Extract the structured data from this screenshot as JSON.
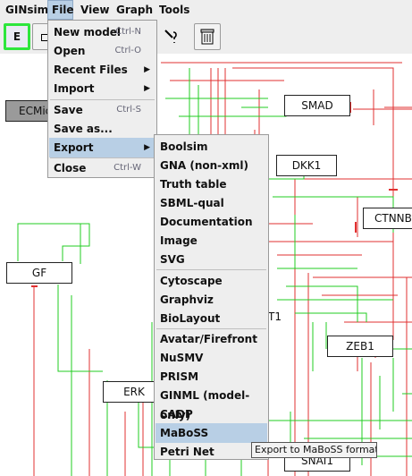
{
  "menubar": {
    "items": [
      {
        "label": "GINsim"
      },
      {
        "label": "File"
      },
      {
        "label": "View"
      },
      {
        "label": "Graph"
      },
      {
        "label": "Tools"
      }
    ]
  },
  "toolbar": {
    "edit_label": "E",
    "icons": [
      "edit-mode-icon",
      "add-node-icon",
      "add-edge-icon",
      "trash-icon"
    ]
  },
  "graph": {
    "nodes": [
      {
        "label": "ECMic"
      },
      {
        "label": "SMAD"
      },
      {
        "label": "DKK1"
      },
      {
        "label": "CTNNB"
      },
      {
        "label": "GF"
      },
      {
        "label": "T1"
      },
      {
        "label": "ZEB1"
      },
      {
        "label": "ERK"
      },
      {
        "label": "SNAI1"
      }
    ]
  },
  "file_menu": {
    "items": [
      {
        "label": "New model",
        "accel": "Ctrl-N"
      },
      {
        "label": "Open",
        "accel": "Ctrl-O"
      },
      {
        "label": "Recent Files",
        "submenu": true
      },
      {
        "label": "Import",
        "submenu": true
      },
      {
        "label": "Save",
        "accel": "Ctrl-S"
      },
      {
        "label": "Save as..."
      },
      {
        "label": "Export",
        "submenu": true
      },
      {
        "label": "Close",
        "accel": "Ctrl-W"
      }
    ]
  },
  "export_menu": {
    "items": [
      {
        "label": "Boolsim"
      },
      {
        "label": "GNA (non-xml)"
      },
      {
        "label": "Truth table"
      },
      {
        "label": "SBML-qual"
      },
      {
        "label": "Documentation"
      },
      {
        "label": "Image"
      },
      {
        "label": "SVG"
      },
      {
        "label": "Cytoscape"
      },
      {
        "label": "Graphviz"
      },
      {
        "label": "BioLayout"
      },
      {
        "label": "Avatar/Firefront"
      },
      {
        "label": "NuSMV"
      },
      {
        "label": "PRISM"
      },
      {
        "label": "GINML (model-only)"
      },
      {
        "label": "CADP"
      },
      {
        "label": "MaBoSS"
      },
      {
        "label": "Petri Net"
      }
    ]
  },
  "tooltip": "Export to MaBoSS format",
  "colors": {
    "activation": "#22cc22",
    "inhibition": "#e03030",
    "highlight": "#b8cfe5",
    "selected_border": "#2ee63c"
  }
}
